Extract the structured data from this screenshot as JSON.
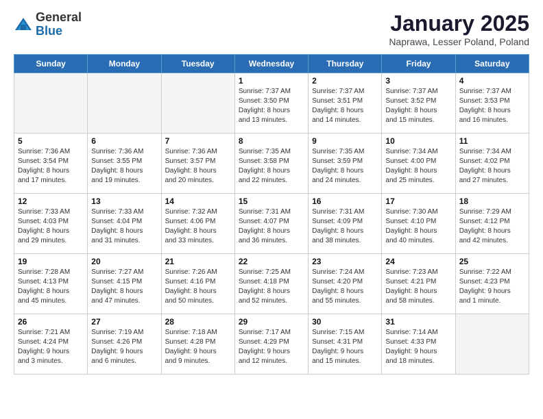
{
  "logo": {
    "general": "General",
    "blue": "Blue"
  },
  "title": "January 2025",
  "subtitle": "Naprawa, Lesser Poland, Poland",
  "days_of_week": [
    "Sunday",
    "Monday",
    "Tuesday",
    "Wednesday",
    "Thursday",
    "Friday",
    "Saturday"
  ],
  "weeks": [
    [
      {
        "day": "",
        "info": ""
      },
      {
        "day": "",
        "info": ""
      },
      {
        "day": "",
        "info": ""
      },
      {
        "day": "1",
        "info": "Sunrise: 7:37 AM\nSunset: 3:50 PM\nDaylight: 8 hours\nand 13 minutes."
      },
      {
        "day": "2",
        "info": "Sunrise: 7:37 AM\nSunset: 3:51 PM\nDaylight: 8 hours\nand 14 minutes."
      },
      {
        "day": "3",
        "info": "Sunrise: 7:37 AM\nSunset: 3:52 PM\nDaylight: 8 hours\nand 15 minutes."
      },
      {
        "day": "4",
        "info": "Sunrise: 7:37 AM\nSunset: 3:53 PM\nDaylight: 8 hours\nand 16 minutes."
      }
    ],
    [
      {
        "day": "5",
        "info": "Sunrise: 7:36 AM\nSunset: 3:54 PM\nDaylight: 8 hours\nand 17 minutes."
      },
      {
        "day": "6",
        "info": "Sunrise: 7:36 AM\nSunset: 3:55 PM\nDaylight: 8 hours\nand 19 minutes."
      },
      {
        "day": "7",
        "info": "Sunrise: 7:36 AM\nSunset: 3:57 PM\nDaylight: 8 hours\nand 20 minutes."
      },
      {
        "day": "8",
        "info": "Sunrise: 7:35 AM\nSunset: 3:58 PM\nDaylight: 8 hours\nand 22 minutes."
      },
      {
        "day": "9",
        "info": "Sunrise: 7:35 AM\nSunset: 3:59 PM\nDaylight: 8 hours\nand 24 minutes."
      },
      {
        "day": "10",
        "info": "Sunrise: 7:34 AM\nSunset: 4:00 PM\nDaylight: 8 hours\nand 25 minutes."
      },
      {
        "day": "11",
        "info": "Sunrise: 7:34 AM\nSunset: 4:02 PM\nDaylight: 8 hours\nand 27 minutes."
      }
    ],
    [
      {
        "day": "12",
        "info": "Sunrise: 7:33 AM\nSunset: 4:03 PM\nDaylight: 8 hours\nand 29 minutes."
      },
      {
        "day": "13",
        "info": "Sunrise: 7:33 AM\nSunset: 4:04 PM\nDaylight: 8 hours\nand 31 minutes."
      },
      {
        "day": "14",
        "info": "Sunrise: 7:32 AM\nSunset: 4:06 PM\nDaylight: 8 hours\nand 33 minutes."
      },
      {
        "day": "15",
        "info": "Sunrise: 7:31 AM\nSunset: 4:07 PM\nDaylight: 8 hours\nand 36 minutes."
      },
      {
        "day": "16",
        "info": "Sunrise: 7:31 AM\nSunset: 4:09 PM\nDaylight: 8 hours\nand 38 minutes."
      },
      {
        "day": "17",
        "info": "Sunrise: 7:30 AM\nSunset: 4:10 PM\nDaylight: 8 hours\nand 40 minutes."
      },
      {
        "day": "18",
        "info": "Sunrise: 7:29 AM\nSunset: 4:12 PM\nDaylight: 8 hours\nand 42 minutes."
      }
    ],
    [
      {
        "day": "19",
        "info": "Sunrise: 7:28 AM\nSunset: 4:13 PM\nDaylight: 8 hours\nand 45 minutes."
      },
      {
        "day": "20",
        "info": "Sunrise: 7:27 AM\nSunset: 4:15 PM\nDaylight: 8 hours\nand 47 minutes."
      },
      {
        "day": "21",
        "info": "Sunrise: 7:26 AM\nSunset: 4:16 PM\nDaylight: 8 hours\nand 50 minutes."
      },
      {
        "day": "22",
        "info": "Sunrise: 7:25 AM\nSunset: 4:18 PM\nDaylight: 8 hours\nand 52 minutes."
      },
      {
        "day": "23",
        "info": "Sunrise: 7:24 AM\nSunset: 4:20 PM\nDaylight: 8 hours\nand 55 minutes."
      },
      {
        "day": "24",
        "info": "Sunrise: 7:23 AM\nSunset: 4:21 PM\nDaylight: 8 hours\nand 58 minutes."
      },
      {
        "day": "25",
        "info": "Sunrise: 7:22 AM\nSunset: 4:23 PM\nDaylight: 9 hours\nand 1 minute."
      }
    ],
    [
      {
        "day": "26",
        "info": "Sunrise: 7:21 AM\nSunset: 4:24 PM\nDaylight: 9 hours\nand 3 minutes."
      },
      {
        "day": "27",
        "info": "Sunrise: 7:19 AM\nSunset: 4:26 PM\nDaylight: 9 hours\nand 6 minutes."
      },
      {
        "day": "28",
        "info": "Sunrise: 7:18 AM\nSunset: 4:28 PM\nDaylight: 9 hours\nand 9 minutes."
      },
      {
        "day": "29",
        "info": "Sunrise: 7:17 AM\nSunset: 4:29 PM\nDaylight: 9 hours\nand 12 minutes."
      },
      {
        "day": "30",
        "info": "Sunrise: 7:15 AM\nSunset: 4:31 PM\nDaylight: 9 hours\nand 15 minutes."
      },
      {
        "day": "31",
        "info": "Sunrise: 7:14 AM\nSunset: 4:33 PM\nDaylight: 9 hours\nand 18 minutes."
      },
      {
        "day": "",
        "info": ""
      }
    ]
  ]
}
